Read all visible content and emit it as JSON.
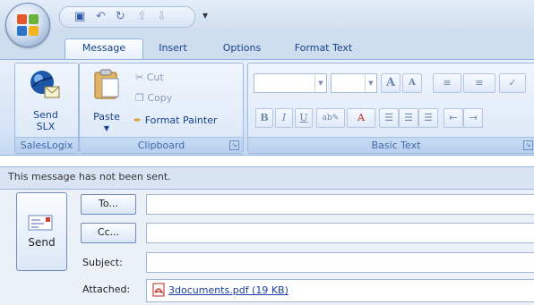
{
  "title_bar": {
    "quick_access": [
      "save-icon",
      "undo-icon",
      "redo-icon",
      "up-arrow-icon",
      "down-arrow-icon",
      "customize-icon"
    ]
  },
  "tabs": [
    {
      "label": "Message",
      "active": true
    },
    {
      "label": "Insert",
      "active": false
    },
    {
      "label": "Options",
      "active": false
    },
    {
      "label": "Format Text",
      "active": false
    }
  ],
  "ribbon": {
    "saleslogix": {
      "send_line1": "Send",
      "send_line2": "SLX",
      "group_label": "SalesLogix"
    },
    "clipboard": {
      "paste_label": "Paste",
      "cut_label": "Cut",
      "copy_label": "Copy",
      "format_painter_label": "Format Painter",
      "group_label": "Clipboard"
    },
    "basic_text": {
      "group_label": "Basic Text",
      "bold": "B",
      "italic": "I",
      "underline": "U",
      "grow_font": "A",
      "shrink_font": "A",
      "font_color": "A"
    }
  },
  "message": {
    "info_text": "This message has not been sent.",
    "send_label": "Send",
    "to_button": "To...",
    "cc_button": "Cc...",
    "subject_label": "Subject:",
    "attached_label": "Attached:",
    "attachment_name": "3documents.pdf (19 KB)",
    "to_value": "",
    "cc_value": "",
    "subject_value": ""
  },
  "colors": {
    "ribbon_bg": "#d6e4f6",
    "accent": "#15428b",
    "link": "#1a3ea3"
  }
}
